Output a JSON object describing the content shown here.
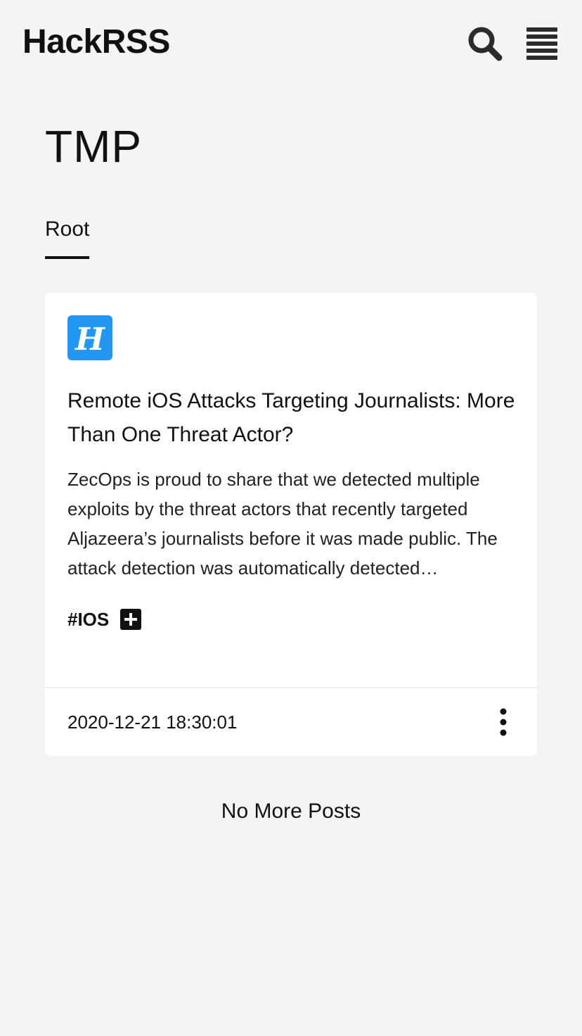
{
  "header": {
    "brand": "HackRSS",
    "search_icon": "search-icon",
    "menu_icon": "menu-icon"
  },
  "page": {
    "title": "TMP",
    "tabs": [
      {
        "label": "Root",
        "active": true
      }
    ]
  },
  "posts": [
    {
      "feed_logo_icon": "hackernews-h-logo",
      "feed_logo_color": "#2196f3",
      "title": "Remote iOS Attacks Targeting Journalists: More Than One Threat Actor?",
      "summary": "ZecOps is proud to share that we detected multiple exploits by the threat actors that recently targeted Aljazeera’s journalists before it was made public. The attack detection was automatically detected…",
      "tags": [
        "#IOS"
      ],
      "add_tag_icon": "plus-square-icon",
      "timestamp": "2020-12-21 18:30:01",
      "more_icon": "more-vertical-icon"
    }
  ],
  "footer": {
    "status": "No More Posts"
  }
}
